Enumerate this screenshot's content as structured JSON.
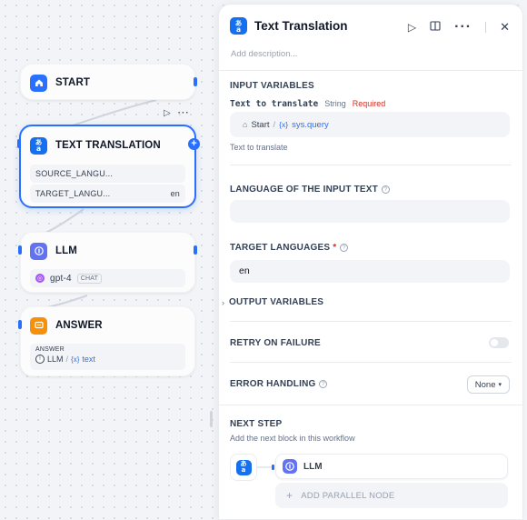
{
  "canvas": {
    "start_node": {
      "title": "START"
    },
    "translation_node": {
      "title": "TEXT TRANSLATION",
      "vars": [
        {
          "name": "SOURCE_LANGU...",
          "value": ""
        },
        {
          "name": "TARGET_LANGU...",
          "value": "en"
        }
      ]
    },
    "llm_node": {
      "title": "LLM",
      "model": "gpt-4",
      "mode": "CHAT"
    },
    "answer_node": {
      "title": "ANSWER",
      "field_label": "ANSWER",
      "ref_source": "LLM",
      "ref_sep": "/",
      "ref_var": "text"
    }
  },
  "panel": {
    "title": "Text Translation",
    "description_placeholder": "Add description...",
    "input_variables": {
      "title": "INPUT VARIABLES",
      "var_name": "Text to translate",
      "var_type": "String",
      "var_required": "Required",
      "ref_source": "Start",
      "ref_sep": "/",
      "ref_var": "sys.query",
      "hint": "Text to translate"
    },
    "language_input": {
      "title": "LANGUAGE OF THE INPUT TEXT",
      "value": ""
    },
    "target_languages": {
      "title": "TARGET LANGUAGES",
      "required_mark": "*",
      "value": "en"
    },
    "output_variables": {
      "title": "OUTPUT VARIABLES"
    },
    "retry": {
      "title": "RETRY ON FAILURE",
      "enabled": false
    },
    "error_handling": {
      "title": "ERROR HANDLING",
      "value": "None"
    },
    "next_step": {
      "title": "NEXT STEP",
      "description": "Add the next block in this workflow",
      "next_node": "LLM",
      "add_parallel": "ADD PARALLEL NODE"
    }
  },
  "colors": {
    "accent": "#2970ff",
    "required": "#d92d20",
    "llm_icon": "#6172f3",
    "answer_icon": "#f79009"
  },
  "icons": [
    "home-icon",
    "translate-icon",
    "llm-icon",
    "answer-icon",
    "play-icon",
    "book-icon",
    "more-icon",
    "close-icon",
    "help-icon",
    "chevron-right-icon",
    "chevron-down-icon",
    "plus-icon",
    "variable-icon"
  ]
}
